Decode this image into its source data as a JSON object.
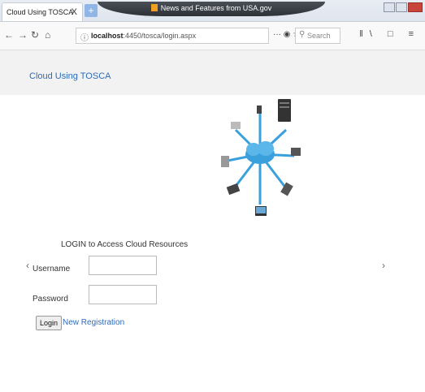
{
  "browser": {
    "tab_title": "Cloud Using TOSCA",
    "tab_close": "X",
    "new_tab": "+",
    "notification": "News and Features from USA.gov",
    "url_info_icon": "ⓘ",
    "url_host": "localhost",
    "url_path": ":4450/tosca/login.aspx",
    "url_actions": "··· ◉ ☆",
    "search_placeholder": "Search",
    "right_icons": "‖\\ □ ≡"
  },
  "site": {
    "brand": "Cloud Using TOSCA",
    "login_title": "LOGIN to Access Cloud Resources",
    "username_label": "Username",
    "password_label": "Password",
    "username_value": "",
    "password_value": "",
    "login_button": "Login",
    "register_link": "New Registration",
    "prev_arrow": "‹",
    "next_arrow": "›"
  },
  "colors": {
    "link": "#2c6bb8",
    "cloud": "#3aa0dc"
  }
}
